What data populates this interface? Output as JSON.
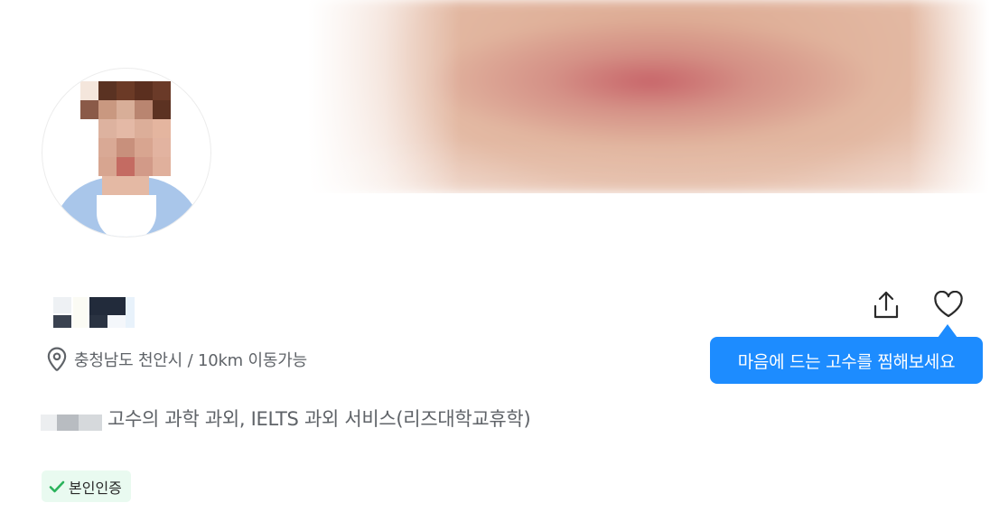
{
  "profile": {
    "location": "충청남도 천안시 / 10km 이동가능",
    "service_title": "고수의 과학 과외, IELTS 과외 서비스(리즈대학교휴학)",
    "verified_badge": "본인인증"
  },
  "actions": {
    "share_icon": "share-icon",
    "like_icon": "heart-icon"
  },
  "tooltip": {
    "text": "마음에 드는 고수를 찜해보세요"
  },
  "colors": {
    "accent": "#1d8cff",
    "badge_bg": "#e9faf0",
    "badge_check": "#2bb35c",
    "muted_text": "#5f6368"
  }
}
